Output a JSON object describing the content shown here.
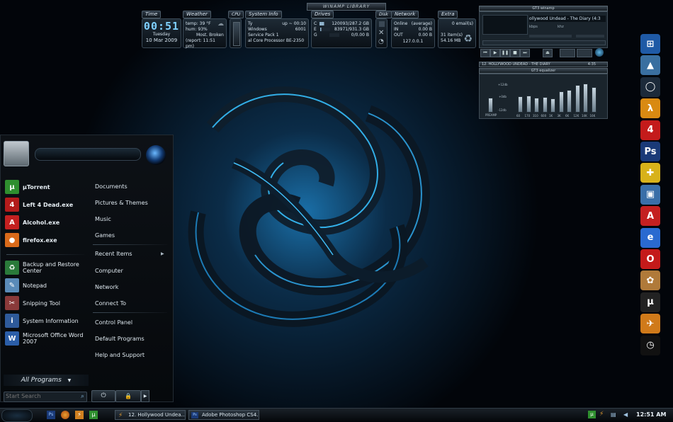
{
  "gadgets": {
    "library_title": "WINAMP LIBRARY",
    "tabs": {
      "time": "Time",
      "weather": "Weather",
      "cpu": "CPU",
      "sysinfo": "System Info",
      "drives": "Drives",
      "disk": "Disk",
      "network": "Network",
      "extra": "Extra"
    },
    "time": {
      "clock": "00:51",
      "day": "Tuesday",
      "date": "10 Mar 2009"
    },
    "weather": {
      "temp": "temp: 39 °F",
      "hum": "hum: 93%",
      "status": "Most. Broken",
      "report": "(report: 11:51 pm)"
    },
    "sysinfo": {
      "user": "Ty",
      "uptime": "up ~ 00:10",
      "os": "Windows",
      "build": "6001",
      "sp": "Service Pack 1",
      "cpu": "al Core Processor BE-2350"
    },
    "drives": [
      {
        "letter": "C",
        "value": "120093/287.2 GB"
      },
      {
        "letter": "E",
        "value": "83971/931.3 GB"
      },
      {
        "letter": "G",
        "value": "0/0.00 B"
      }
    ],
    "network": {
      "status": "Online",
      "mode": "(average)",
      "in_label": "IN",
      "in_value": "0.00 B",
      "out_label": "OUT",
      "out_value": "0.00 B",
      "ip": "127.0.0.1"
    },
    "extra": {
      "email": "0 email(s)",
      "items": "31 item(s)",
      "size": "54.16 MB"
    }
  },
  "winamp": {
    "title": "GT3 winamp",
    "track": "ollywood Undead - The Diary (4:3",
    "kbps": "kbps",
    "khz": "khz",
    "playlist_entry": "12. HOLLYWOOD UNDEAD - THE DIARY",
    "playlist_time": "4:35",
    "eq_title": "GT3 equalizer",
    "eq_labels": {
      "plus": "+12db",
      "zero": "+0db",
      "minus": "-12db",
      "preamp": "PREAMP"
    },
    "eq_bands": [
      "60",
      "170",
      "310",
      "600",
      "1K",
      "3K",
      "6K",
      "12K",
      "14K",
      "16K"
    ],
    "eq_levels": [
      0.45,
      0.48,
      0.42,
      0.44,
      0.4,
      0.6,
      0.66,
      0.8,
      0.84,
      0.74
    ]
  },
  "startmenu": {
    "pinned": [
      {
        "label": "µTorrent",
        "icon": "utorrent-icon",
        "glyph": "µ",
        "color": "#2f8f2f"
      },
      {
        "label": "Left 4 Dead.exe",
        "icon": "left4dead-icon",
        "glyph": "4",
        "color": "#b31b1b"
      },
      {
        "label": "Alcohol.exe",
        "icon": "alcohol-icon",
        "glyph": "A",
        "color": "#c42020"
      },
      {
        "label": "firefox.exe",
        "icon": "firefox-icon",
        "glyph": "●",
        "color": "#d96a1a"
      }
    ],
    "recent": [
      {
        "label": "Backup and Restore",
        "label2": "Center",
        "icon": "backup-icon",
        "glyph": "♻",
        "color": "#2a7a3a"
      },
      {
        "label": "Notepad",
        "icon": "notepad-icon",
        "glyph": "✎",
        "color": "#5a8bb8"
      },
      {
        "label": "Snipping Tool",
        "icon": "snipping-icon",
        "glyph": "✂",
        "color": "#8a3a3a"
      },
      {
        "label": "System Information",
        "icon": "sysinfo-icon",
        "glyph": "i",
        "color": "#2e5a9a"
      },
      {
        "label": "Microsoft Office Word",
        "label2": "2007",
        "icon": "word-icon",
        "glyph": "W",
        "color": "#2b5ea8"
      }
    ],
    "all_programs": "All Programs",
    "search_placeholder": "Start Search",
    "right": [
      "Documents",
      "Pictures & Themes",
      "Music",
      "Games",
      "Recent Items",
      "Computer",
      "Network",
      "Connect To",
      "Control Panel",
      "Default Programs",
      "Help and Support"
    ]
  },
  "dock": [
    {
      "icon": "windows-icon",
      "glyph": "⊞",
      "color": "#1f5aa6"
    },
    {
      "icon": "app-icon",
      "glyph": "▲",
      "color": "#3a6fa0"
    },
    {
      "icon": "ring-icon",
      "glyph": "◯",
      "color": "#1c2a3a"
    },
    {
      "icon": "half-life-icon",
      "glyph": "λ",
      "color": "#d98a12"
    },
    {
      "icon": "left4dead-icon",
      "glyph": "4",
      "color": "#c41b1b"
    },
    {
      "icon": "photoshop-icon",
      "glyph": "Ps",
      "color": "#1a3a78"
    },
    {
      "icon": "puzzle-icon",
      "glyph": "✚",
      "color": "#d8b21a"
    },
    {
      "icon": "computer-icon",
      "glyph": "▣",
      "color": "#3a6fa8"
    },
    {
      "icon": "alcohol-icon",
      "glyph": "A",
      "color": "#c42020"
    },
    {
      "icon": "internet-icon",
      "glyph": "e",
      "color": "#2a6ad0"
    },
    {
      "icon": "opera-icon",
      "glyph": "O",
      "color": "#c41a1a"
    },
    {
      "icon": "paint-icon",
      "glyph": "✿",
      "color": "#b07a3a"
    },
    {
      "icon": "utorrent-icon",
      "glyph": "µ",
      "color": "#222"
    },
    {
      "icon": "tool-icon",
      "glyph": "✈",
      "color": "#d07a1a"
    },
    {
      "icon": "clock-icon",
      "glyph": "◷",
      "color": "#111"
    }
  ],
  "taskbar": {
    "buttons": [
      {
        "label": "12. Hollywood Undea...",
        "icon": "winamp-icon"
      },
      {
        "label": "Adobe Photoshop CS4...",
        "icon": "photoshop-icon"
      }
    ],
    "clock": "12:51 AM"
  },
  "colors": {
    "accent": "#1aa3e6",
    "panel": "#1e2a35",
    "text": "#cfe3f2"
  }
}
